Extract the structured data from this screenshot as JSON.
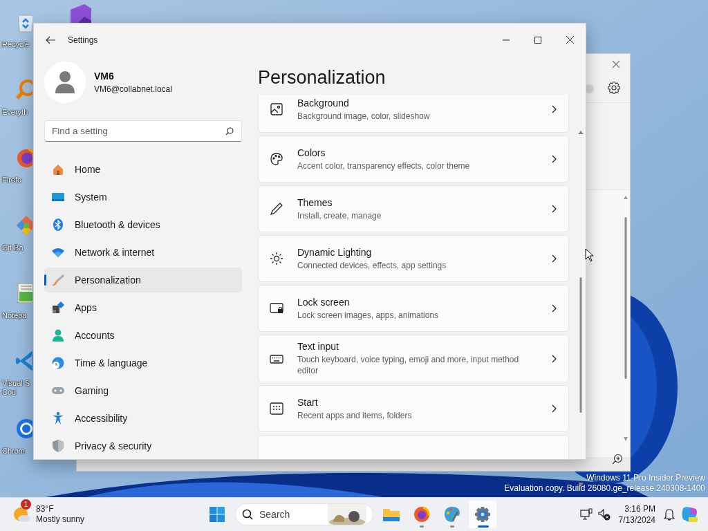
{
  "desktop": {
    "icons": [
      {
        "lines": [
          "Recycle"
        ]
      },
      {
        "lines": [
          "Everyth"
        ]
      },
      {
        "lines": [
          "Firefo"
        ]
      },
      {
        "lines": [
          "Git Ba"
        ]
      },
      {
        "lines": [
          "Notepa"
        ]
      },
      {
        "lines": [
          "Visual S",
          "Cod"
        ]
      },
      {
        "lines": [
          "Chrom"
        ]
      }
    ]
  },
  "settings_window": {
    "title": "Settings",
    "account": {
      "name": "VM6",
      "email": "VM6@collabnet.local"
    },
    "search": {
      "placeholder": "Find a setting"
    },
    "nav": [
      {
        "label": "Home",
        "selected": false
      },
      {
        "label": "System",
        "selected": false
      },
      {
        "label": "Bluetooth & devices",
        "selected": false
      },
      {
        "label": "Network & internet",
        "selected": false
      },
      {
        "label": "Personalization",
        "selected": true
      },
      {
        "label": "Apps",
        "selected": false
      },
      {
        "label": "Accounts",
        "selected": false
      },
      {
        "label": "Time & language",
        "selected": false
      },
      {
        "label": "Gaming",
        "selected": false
      },
      {
        "label": "Accessibility",
        "selected": false
      },
      {
        "label": "Privacy & security",
        "selected": false
      }
    ],
    "page_title": "Personalization",
    "cards": [
      {
        "title": "Background",
        "subtitle": "Background image, color, slideshow"
      },
      {
        "title": "Colors",
        "subtitle": "Accent color, transparency effects, color theme"
      },
      {
        "title": "Themes",
        "subtitle": "Install, create, manage"
      },
      {
        "title": "Dynamic Lighting",
        "subtitle": "Connected devices, effects, app settings"
      },
      {
        "title": "Lock screen",
        "subtitle": "Lock screen images, apps, animations"
      },
      {
        "title": "Text input",
        "subtitle": "Touch keyboard, voice typing, emoji and more, input method editor"
      },
      {
        "title": "Start",
        "subtitle": "Recent apps and items, folders"
      }
    ]
  },
  "build_info": [
    "Windows 11 Pro Insider Preview",
    "Evaluation copy. Build 26080.ge_release.240308-1400"
  ],
  "taskbar": {
    "weather": {
      "badge": "1",
      "temperature": "83°F",
      "condition": "Mostly sunny"
    },
    "search": {
      "placeholder": "Search"
    },
    "apps": [
      {
        "kind": "explorer",
        "running": false,
        "selected": false
      },
      {
        "kind": "firefox",
        "running": true,
        "selected": false
      },
      {
        "kind": "paint",
        "running": true,
        "selected": false
      },
      {
        "kind": "settings",
        "running": true,
        "selected": true
      }
    ],
    "clock": {
      "time": "3:16 PM",
      "date": "7/13/2024"
    }
  }
}
